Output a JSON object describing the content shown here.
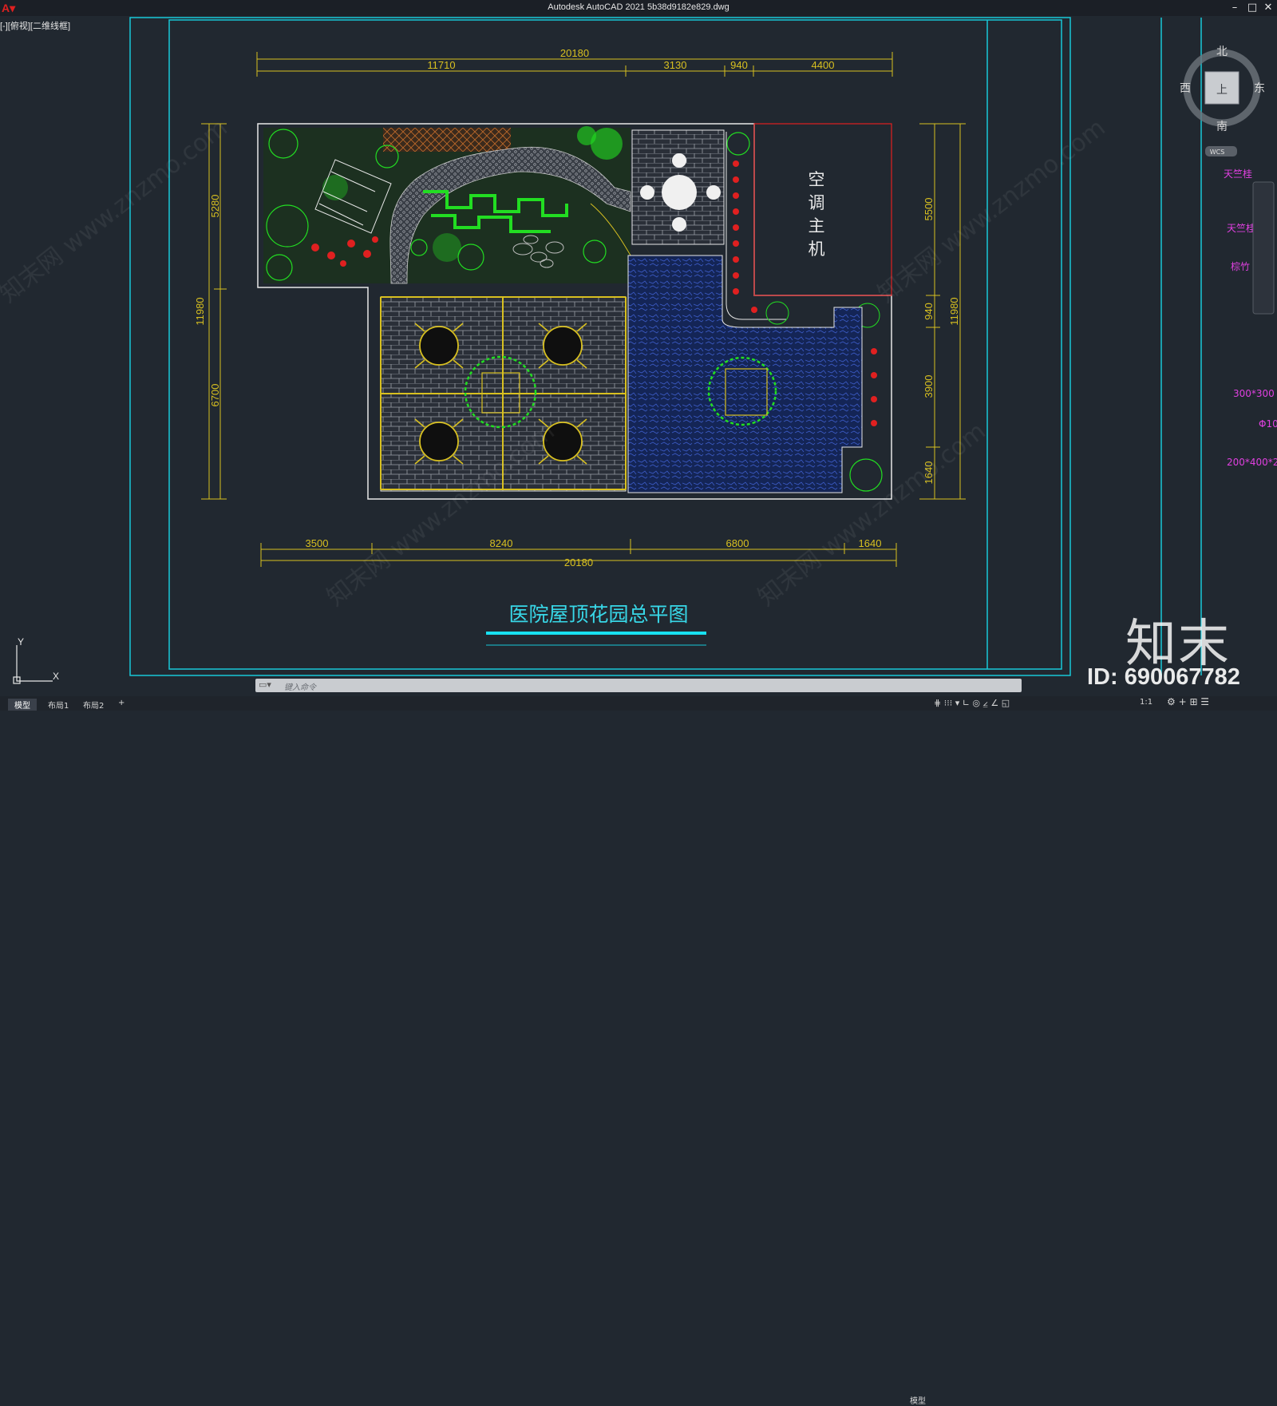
{
  "window": {
    "title": "Autodesk AutoCAD 2021    5b38d9182e829.dwg",
    "viewport_controls": "[-][俯视][二维线框]"
  },
  "drawing": {
    "title": "医院屋顶花园总平图",
    "top_dims": {
      "total": "20180",
      "parts": [
        "11710",
        "3130",
        "940",
        "4400"
      ]
    },
    "bottom_dims": {
      "total": "20180",
      "parts": [
        "3500",
        "8240",
        "6800",
        "1640"
      ]
    },
    "left_dims": {
      "total": "11980",
      "parts": [
        "5280",
        "6700"
      ]
    },
    "right_dims": {
      "total": "11980",
      "parts": [
        "5500",
        "940",
        "3900",
        "1640"
      ]
    },
    "ac_unit_label": [
      "空",
      "调",
      "主",
      "机"
    ]
  },
  "viewcube": {
    "north": "北",
    "south": "南",
    "east": "东",
    "west": "西",
    "face": "上",
    "wcs": "WCS"
  },
  "side_panel": {
    "labels": [
      "天竺桂",
      "天竺桂",
      "棕竹",
      "300*300",
      "Φ10",
      "200*400*2"
    ]
  },
  "ucs": {
    "x": "X",
    "y": "Y"
  },
  "command": {
    "placeholder": "键入命令"
  },
  "layout_tabs": [
    "模型",
    "布局1",
    "布局2",
    "+"
  ],
  "status": {
    "model": "模型",
    "scale": "1:1"
  },
  "watermark": {
    "brand": "知末",
    "id": "ID: 690067782",
    "site": "知末网 www.znzmo.com"
  },
  "colors": {
    "background": "#212830",
    "frame": "#18c8d8",
    "dimension": "#d8c020",
    "boundary": "#e8e8e8",
    "plant": "#22dd22",
    "flower": "#e02020",
    "water": "#203a8a",
    "magenta": "#e040e0"
  }
}
